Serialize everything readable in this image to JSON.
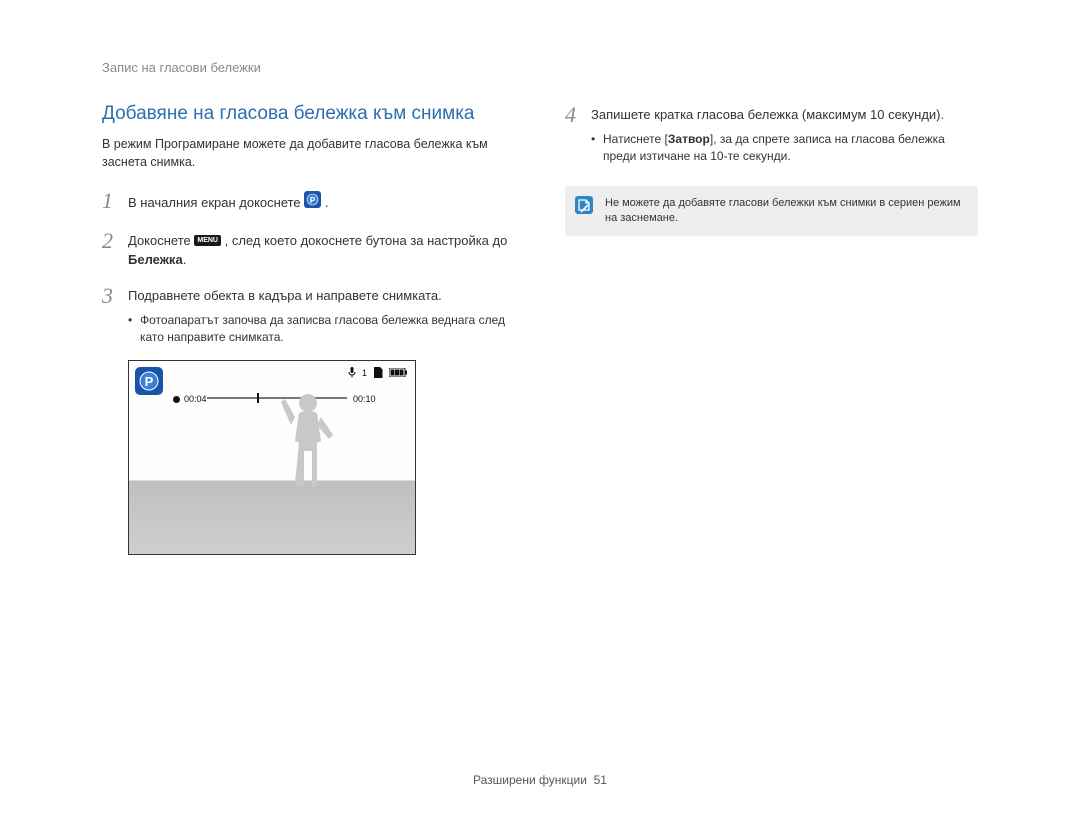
{
  "header": "Запис на гласови бележки",
  "section_title": "Добавяне на гласова бележка към снимка",
  "intro": "В режим Програмиране можете да добавите гласова бележка към заснета снимка.",
  "steps": {
    "s1": {
      "num": "1",
      "pre": "В началния екран докоснете ",
      "post": "."
    },
    "s2": {
      "num": "2",
      "pre": "Докоснете ",
      "mid": ", след което докоснете бутона за настройка до ",
      "bold": "Бележка",
      "post": "."
    },
    "s3": {
      "num": "3",
      "text": "Подравнете обекта в кадъра и направете снимката.",
      "bullet": "Фотоапаратът започва да записва гласова бележка веднага след като направите снимката."
    },
    "s4": {
      "num": "4",
      "text": "Запишете кратка гласова бележка (максимум 10 секунди).",
      "bullet_pre": "Натиснете [",
      "bullet_bold": "Затвор",
      "bullet_post": "], за да спрете записа на гласова бележка преди изтичане на 10-те секунди."
    }
  },
  "menu_label": "MENU",
  "screenshot": {
    "elapsed": "00:04",
    "total": "00:10",
    "count": "1"
  },
  "note": "Не можете да добавяте гласови бележки към снимки в сериен режим на заснемане.",
  "footer": {
    "label": "Разширени функции",
    "page": "51"
  }
}
